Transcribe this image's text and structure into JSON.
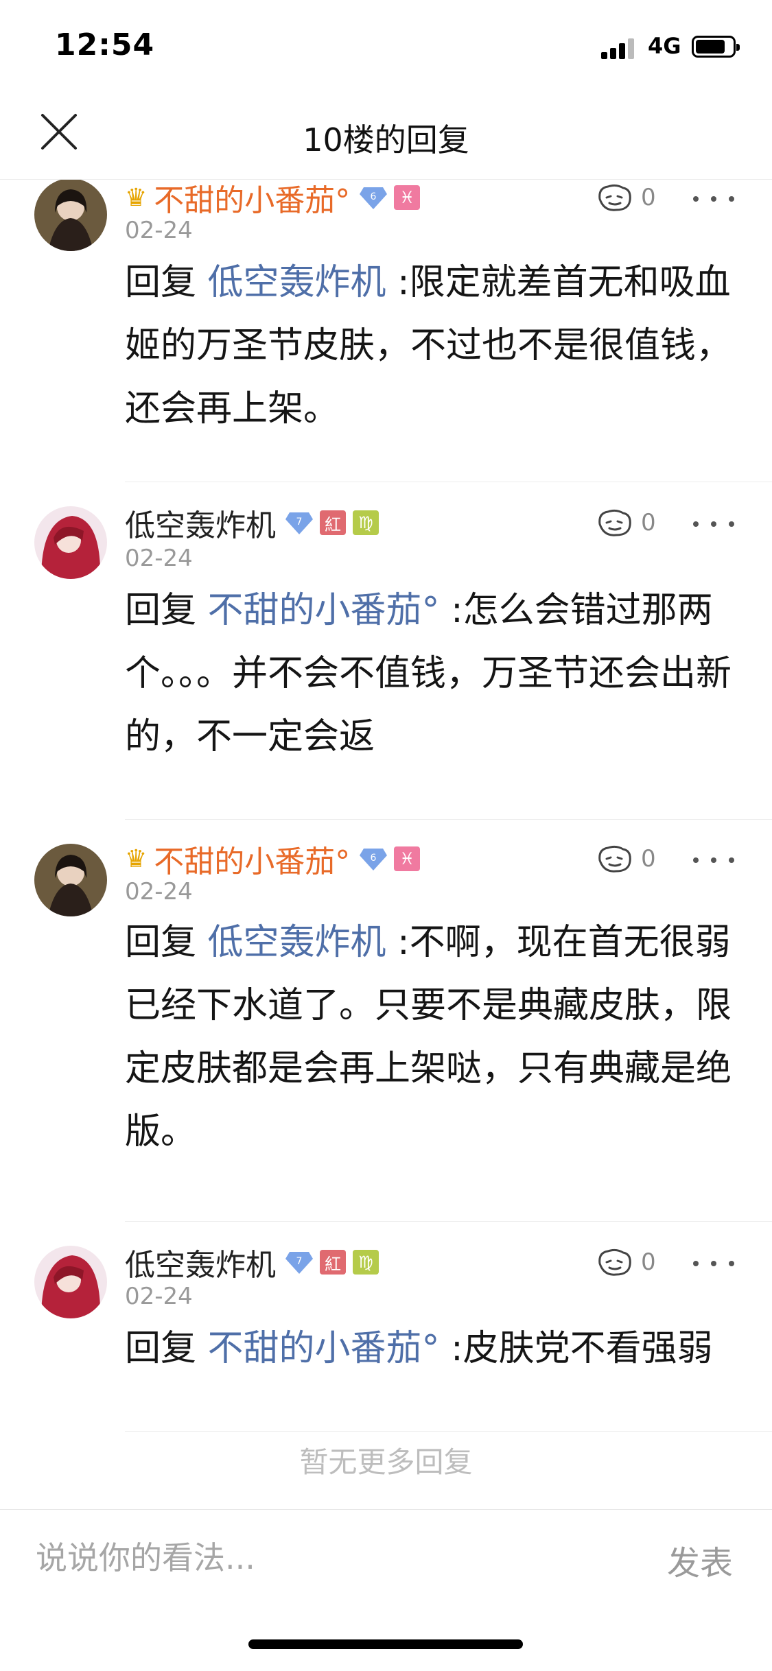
{
  "status_bar": {
    "time": "12:54",
    "network": "4G"
  },
  "header": {
    "title": "10楼的回复"
  },
  "replies": [
    {
      "username": "不甜的小番茄°",
      "level": "6",
      "zodiac": "♓",
      "date": "02-24",
      "likes": "0",
      "prefix": "回复",
      "mention": "低空轰炸机",
      "text": ":限定就差首无和吸血姬的万圣节皮肤，不过也不是很值钱，还会再上架。"
    },
    {
      "username": "低空轰炸机",
      "level": "7",
      "badge": "紅",
      "zodiac": "♍",
      "date": "02-24",
      "likes": "0",
      "prefix": "回复",
      "mention": "不甜的小番茄°",
      "text": ":怎么会错过那两个。。。并不会不值钱，万圣节还会出新的，不一定会返"
    },
    {
      "username": "不甜的小番茄°",
      "level": "6",
      "zodiac": "♓",
      "date": "02-24",
      "likes": "0",
      "prefix": "回复",
      "mention": "低空轰炸机",
      "text": ":不啊，现在首无很弱已经下水道了。只要不是典藏皮肤，限定皮肤都是会再上架哒，只有典藏是绝版。"
    },
    {
      "username": "低空轰炸机",
      "level": "7",
      "badge": "紅",
      "zodiac": "♍",
      "date": "02-24",
      "likes": "0",
      "prefix": "回复",
      "mention": "不甜的小番茄°",
      "text": ":皮肤党不看强弱"
    }
  ],
  "no_more_text": "暂无更多回复",
  "comment": {
    "placeholder": "说说你的看法...",
    "value": ""
  },
  "send_label": "发表",
  "colors": {
    "username_vip": "#e86a28",
    "mention": "#4f6fa8",
    "level_badge": "#7aa3e8"
  }
}
